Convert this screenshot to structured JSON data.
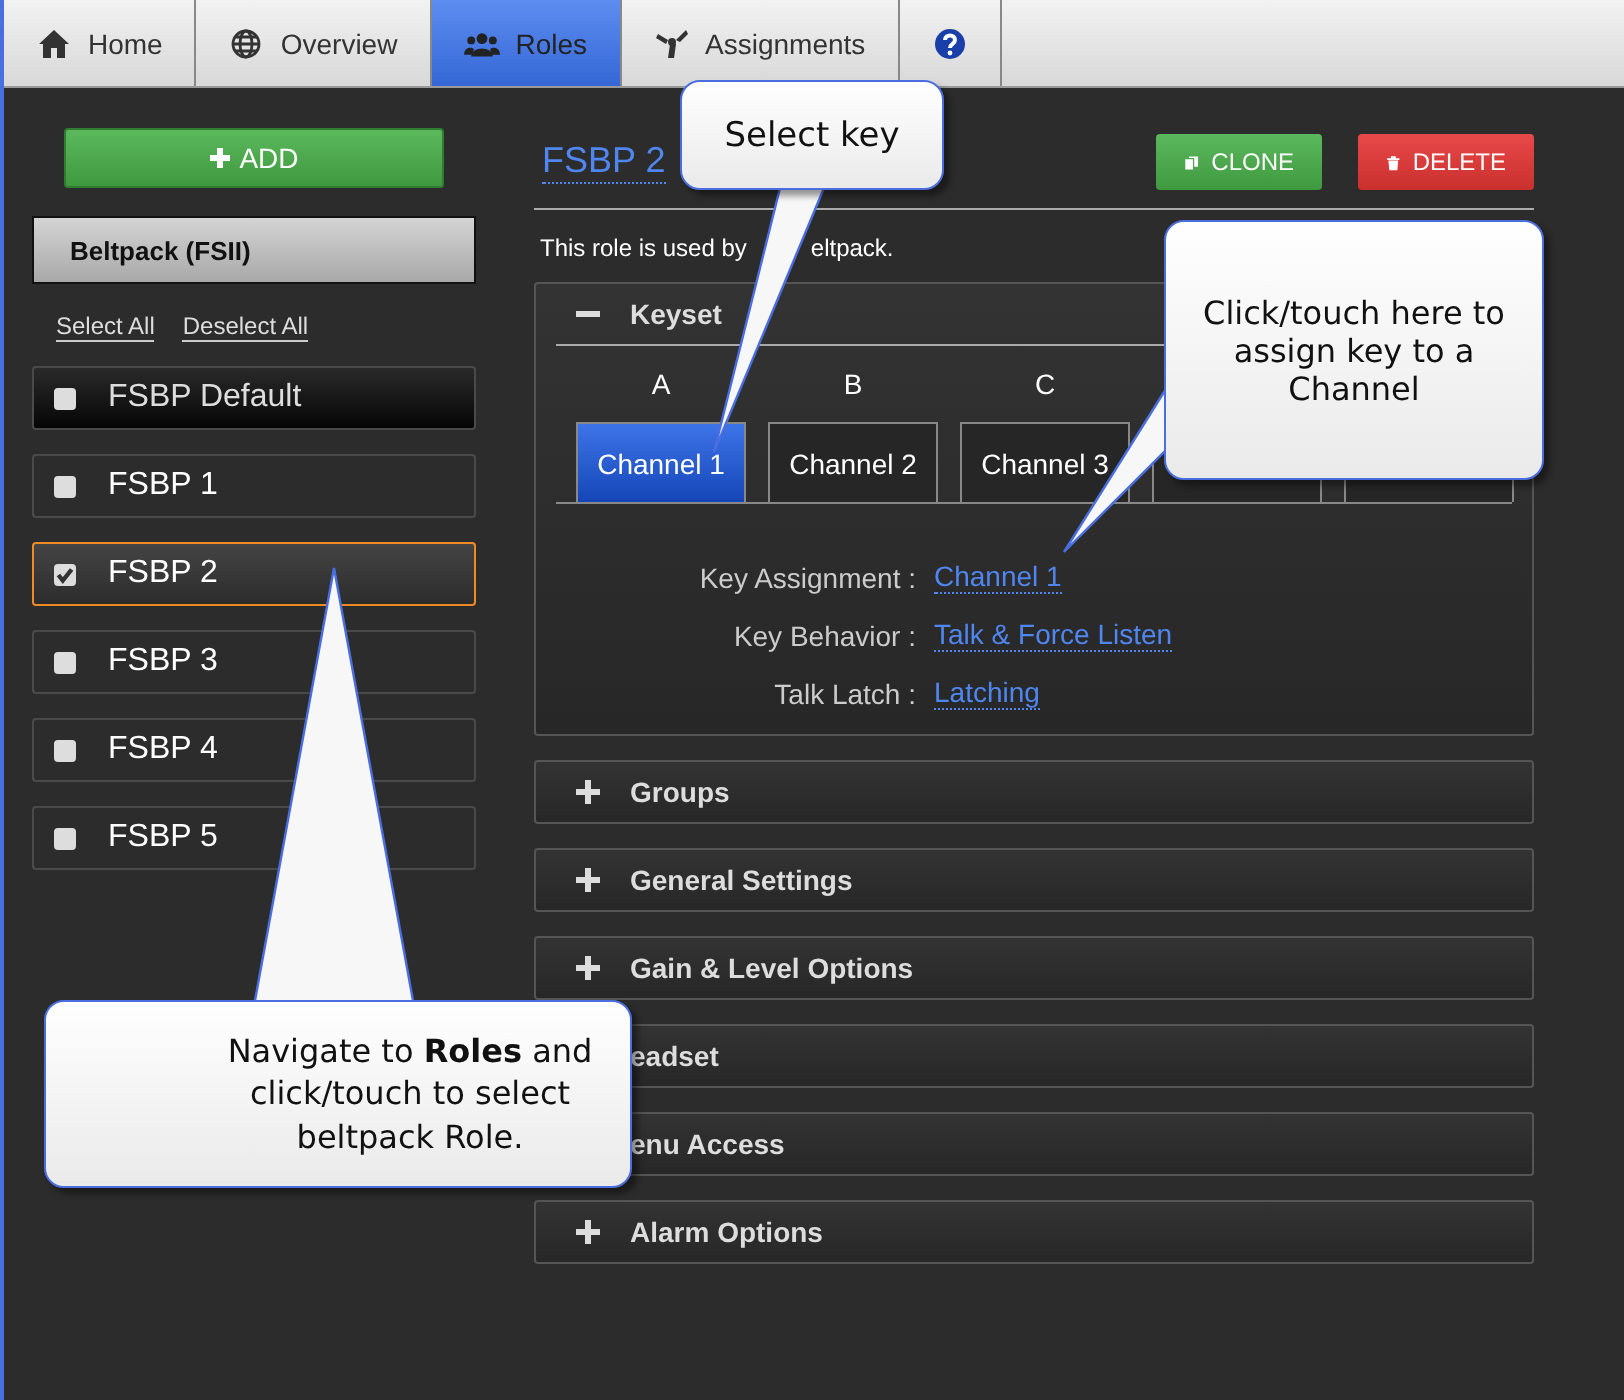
{
  "tabs": [
    {
      "label": "Home",
      "selected": false
    },
    {
      "label": "Overview",
      "selected": false
    },
    {
      "label": "Roles",
      "selected": true
    },
    {
      "label": "Assignments",
      "selected": false
    },
    {
      "selected": false
    }
  ],
  "sidebar": {
    "add_button": "ADD",
    "device_type": "Beltpack (FSII)",
    "select_all": "Select All",
    "deselect_all": "Deselect All",
    "roles": [
      {
        "name": "FSBP Default",
        "checked": false,
        "selected": false,
        "kind": "default"
      },
      {
        "name": "FSBP 1",
        "checked": false,
        "selected": false,
        "kind": "role"
      },
      {
        "name": "FSBP 2",
        "checked": true,
        "selected": true,
        "kind": "role"
      },
      {
        "name": "FSBP 3",
        "checked": false,
        "selected": false,
        "kind": "role"
      },
      {
        "name": "FSBP 4",
        "checked": false,
        "selected": false,
        "kind": "role"
      },
      {
        "name": "FSBP 5",
        "checked": false,
        "selected": false,
        "kind": "role"
      }
    ]
  },
  "role": {
    "title": "FSBP 2",
    "clone_button": "CLONE",
    "delete_button": "DELETE",
    "usage_parts": [
      "This role is used by",
      "eltpack."
    ],
    "sections": [
      {
        "title": "Keyset",
        "expanded": true
      },
      {
        "title": "Groups",
        "expanded": false
      },
      {
        "title": "General Settings",
        "expanded": false
      },
      {
        "title": "Gain & Level Options",
        "expanded": false
      },
      {
        "title": "eadset",
        "expanded": false
      },
      {
        "title": "enu Access",
        "expanded": false
      },
      {
        "title": "Alarm Options",
        "expanded": false
      }
    ],
    "keys": [
      {
        "label": "A",
        "button": "Channel 1",
        "selected": true
      },
      {
        "label": "B",
        "button": "Channel 2",
        "selected": false
      },
      {
        "label": "C",
        "button": "Channel 3",
        "selected": false
      },
      {
        "selected": false
      },
      {
        "selected": false
      }
    ],
    "settings": [
      {
        "label": "Key Assignment :",
        "value": "Channel 1"
      },
      {
        "label": "Key Behavior :",
        "value": "Talk & Force Listen"
      },
      {
        "label": "Talk Latch :",
        "value": "Latching"
      }
    ]
  },
  "callouts": [
    {
      "text": "Select  key",
      "kind": "select"
    },
    {
      "text": "Click/touch here to assign key to a Channel",
      "kind": "assign"
    },
    {
      "text": "Navigate to **Roles** and click/touch to select beltpack Role.",
      "kind": "nav"
    }
  ]
}
